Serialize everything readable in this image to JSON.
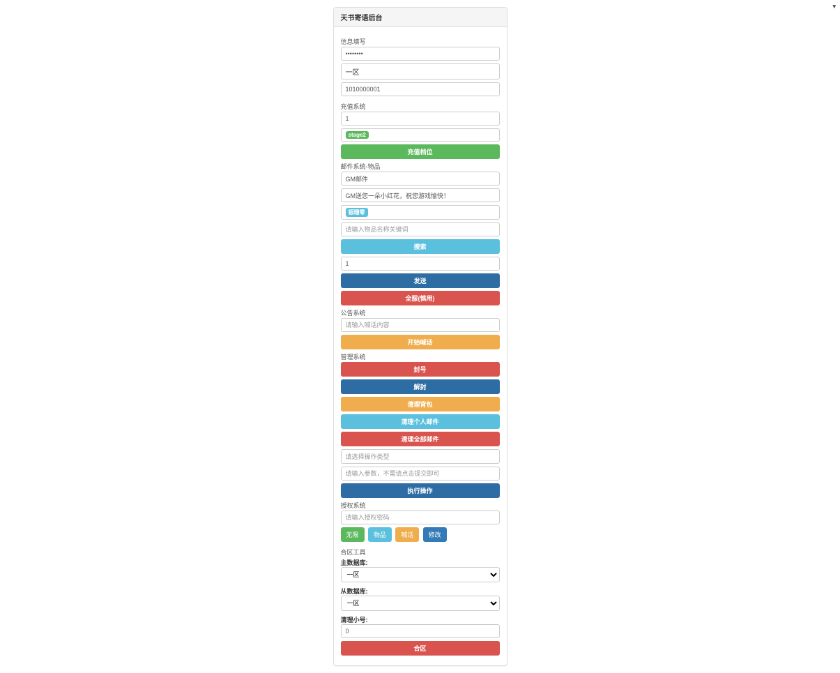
{
  "heading": "天书寄语后台",
  "info": {
    "label": "信息填写",
    "password_value": "••••••••",
    "zone_selected": "一区",
    "id_value": "1010000001"
  },
  "recharge": {
    "label": "充值系统",
    "amount_value": "1",
    "badge": "stage2",
    "btn": "充值档位"
  },
  "mail": {
    "label": "邮件系统-物品",
    "title_value": "GM邮件",
    "body_value": "GM送您一朵小红花，祝您游戏愉快！",
    "badge": "银珊零",
    "search_placeholder": "请输入物品名称关键词",
    "search_btn": "搜索",
    "qty_value": "1",
    "send_btn": "发送",
    "sendall_btn": "全服(慎用)"
  },
  "announce": {
    "label": "公告系统",
    "placeholder": "请输入喊话内容",
    "btn": "开始喊话"
  },
  "manage": {
    "label": "管理系统",
    "ban_btn": "封号",
    "unban_btn": "解封",
    "clear_bag_btn": "清理背包",
    "clear_self_mail_btn": "清理个人邮件",
    "clear_all_mail_btn": "清理全部邮件",
    "type_placeholder": "请选择操作类型",
    "param_placeholder": "请输入参数，不需请点击提交即可",
    "exec_btn": "执行操作"
  },
  "auth": {
    "label": "授权系统",
    "placeholder": "请输入授权密码",
    "none": "无限",
    "item": "物品",
    "shout": "喊话",
    "modify": "修改"
  },
  "merge": {
    "label": "合区工具",
    "main_label": "主数据库:",
    "sub_label": "从数据库:",
    "zone": "一区",
    "clean_label": "清理小号:",
    "clean_value": "0",
    "btn": "合区"
  }
}
